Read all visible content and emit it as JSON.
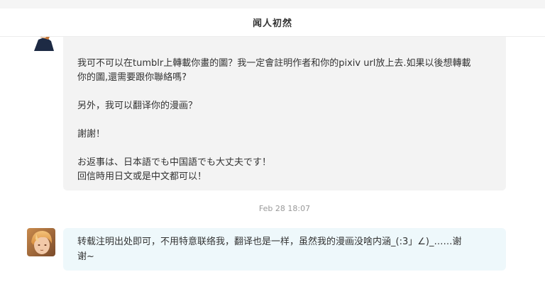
{
  "header": {
    "title": "闻人初然"
  },
  "messages": [
    {
      "sender": "other",
      "partial_top_text": " ",
      "lines": [
        "我可不可以在tumblr上轉載你畫的圖？我一定會註明作者和你的pixiv url放上去.如果以後想轉載",
        "你的圖,還需要跟你聯絡嗎?",
        "另外，我可以翻译你的漫画？",
        "謝謝！",
        "お返事は、日本語でも中国語でも大丈夫です！",
        "回信時用日文或是中文都可以！"
      ]
    },
    {
      "sender": "me",
      "timestamp": "Feb 28 18:07",
      "lines": [
        "转载注明出处即可，不用特意联络我，翻译也是一样，虽然我的漫画没啥内涵_(:3」∠)_……谢",
        "谢~"
      ]
    }
  ],
  "colors": {
    "bubble_other": "#f3f3f3",
    "bubble_me": "#eef8fb",
    "timestamp": "#999999",
    "text": "#333333"
  }
}
